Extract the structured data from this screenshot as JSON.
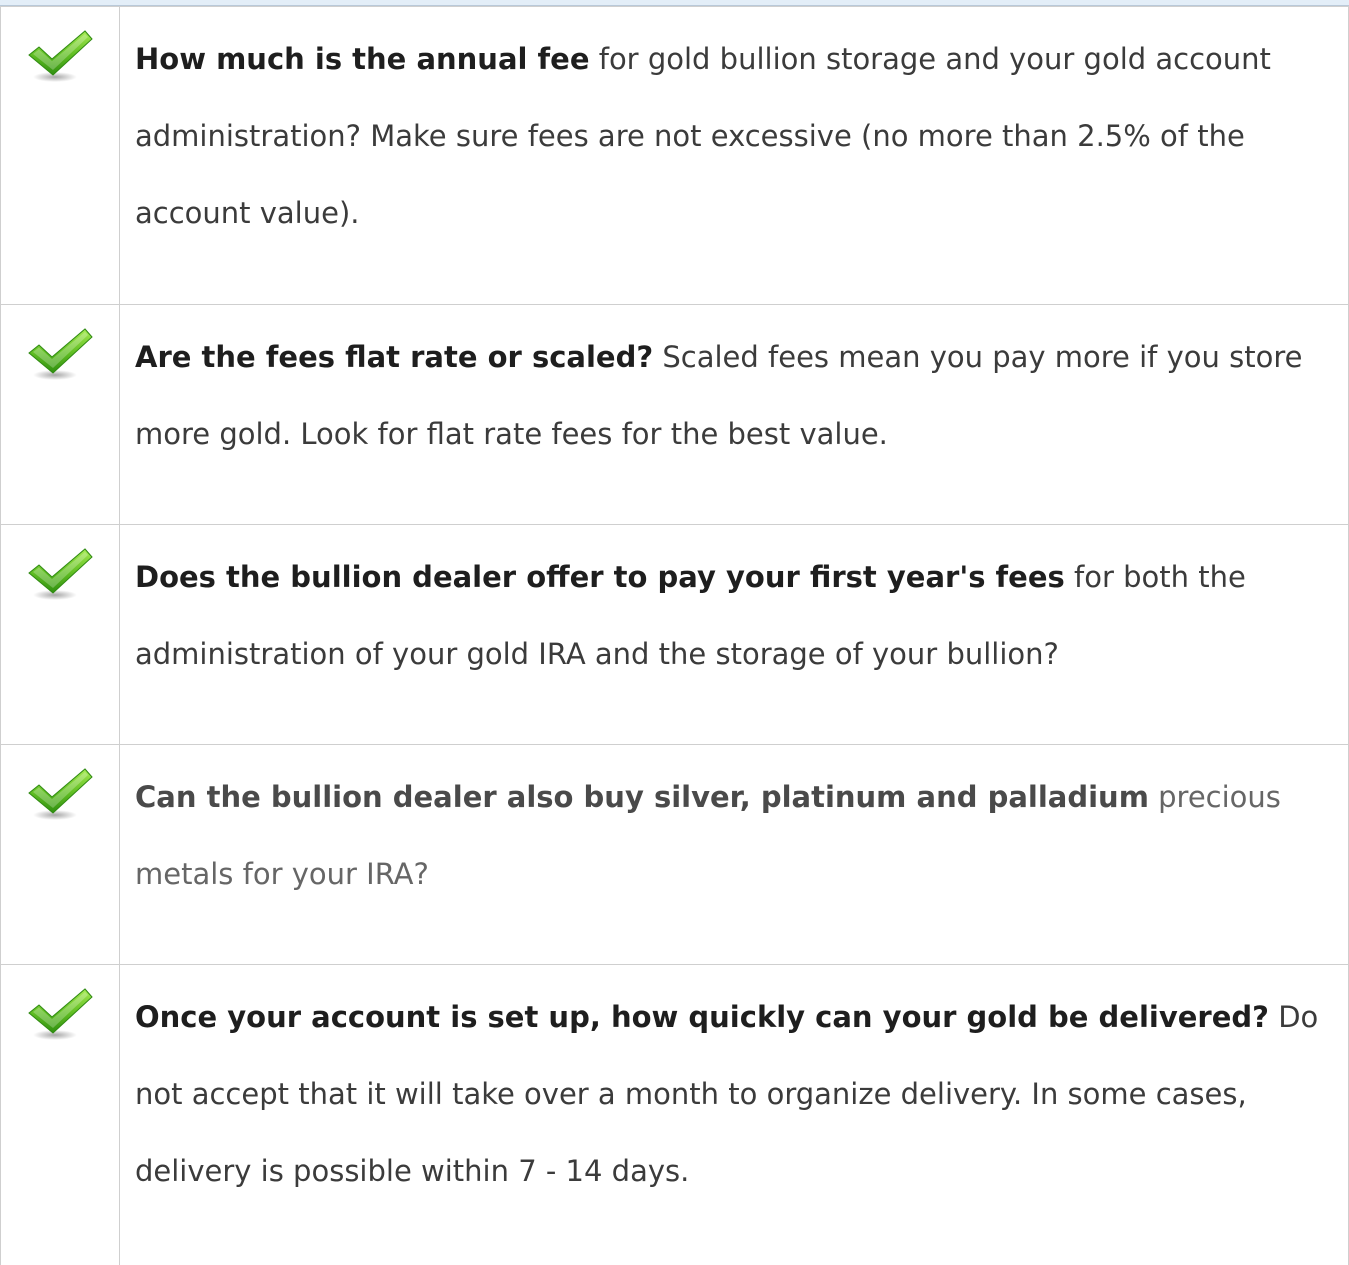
{
  "checklist": {
    "items": [
      {
        "lead": "How much is the annual fee",
        "text": " for gold bullion storage and your gold account administration? Make sure fees are not excessive (no more than 2.5% of the account value)."
      },
      {
        "lead": "Are the fees flat rate or scaled?",
        "text": " Scaled fees mean you pay more if you store more gold. Look for flat rate fees for the best value."
      },
      {
        "lead": "Does the bullion dealer offer to pay your first year's fees",
        "text": " for both the administration of your gold IRA and the storage of your bullion?"
      },
      {
        "lead": "Can the bullion dealer also buy silver, platinum and palladium",
        "text": " precious metals for your IRA?"
      },
      {
        "lead": "Once your account is set up, how quickly can your gold be delivered?",
        "text": " Do not accept that it will take over a month to organize delivery. In some cases, delivery is possible within 7 - 14 days."
      }
    ],
    "icon": "check-icon",
    "colors": {
      "check_light": "#8fdc3c",
      "check_dark": "#2f8f10",
      "border": "#cfcfcf",
      "header_strip": "#e3eef8"
    }
  }
}
